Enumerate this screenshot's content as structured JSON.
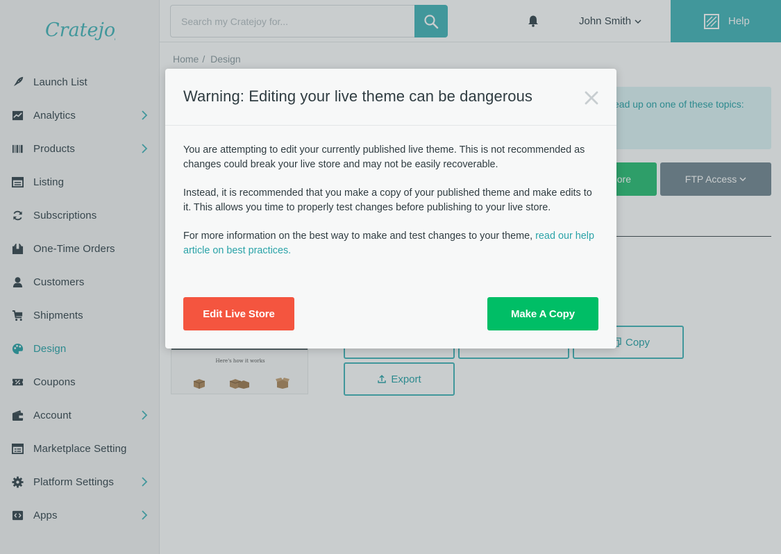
{
  "brand": {
    "logo_text": "Cratejoy"
  },
  "search": {
    "placeholder": "Search my Cratejoy for..."
  },
  "header": {
    "user_name": "John Smith",
    "help_label": "Help"
  },
  "sidebar": {
    "items": [
      {
        "label": "Launch List",
        "icon": "rocket-icon",
        "chevron": false
      },
      {
        "label": "Analytics",
        "icon": "chart-icon",
        "chevron": true
      },
      {
        "label": "Products",
        "icon": "barcode-icon",
        "chevron": true
      },
      {
        "label": "Listing",
        "icon": "list-icon",
        "chevron": false
      },
      {
        "label": "Subscriptions",
        "icon": "refresh-icon",
        "chevron": false
      },
      {
        "label": "One-Time Orders",
        "icon": "package-icon",
        "chevron": false
      },
      {
        "label": "Customers",
        "icon": "person-icon",
        "chevron": false
      },
      {
        "label": "Shipments",
        "icon": "cart-icon",
        "chevron": false
      },
      {
        "label": "Design",
        "icon": "palette-icon",
        "chevron": false,
        "active": true
      },
      {
        "label": "Coupons",
        "icon": "coupon-icon",
        "chevron": false
      },
      {
        "label": "Account",
        "icon": "wallet-icon",
        "chevron": true
      },
      {
        "label": "Marketplace Setting",
        "icon": "store-icon",
        "chevron": false
      },
      {
        "label": "Platform Settings",
        "icon": "gear-icon",
        "chevron": true
      },
      {
        "label": "Apps",
        "icon": "code-icon",
        "chevron": true
      }
    ]
  },
  "breadcrumb": {
    "home": "Home",
    "sep": "/",
    "current": "Design"
  },
  "page": {
    "info_text": "ead up on one of these topics:",
    "store_button": "ore",
    "ftp_button": "FTP Access",
    "thumb_text": "Here's how it works",
    "copy_button": "Copy",
    "export_button": "Export"
  },
  "modal": {
    "title": "Warning: Editing your live theme can be dangerous",
    "para1": "You are attempting to edit your currently published live theme. This is not recommended as changes could break your live store and may not be easily recoverable.",
    "para2": "Instead, it is recommended that you make a copy of your published theme and make edits to it. This allows you time to properly test changes before publishing to your live store.",
    "para3_text": "For more information on the best way to make and test changes to your theme, ",
    "para3_link": "read our help article on best practices.",
    "edit_button": "Edit Live Store",
    "copy_button": "Make A Copy"
  },
  "colors": {
    "accent": "#45b5ba",
    "danger": "#f4553f",
    "success": "#00be66",
    "sidebar_bg": "#f4f5f5"
  }
}
